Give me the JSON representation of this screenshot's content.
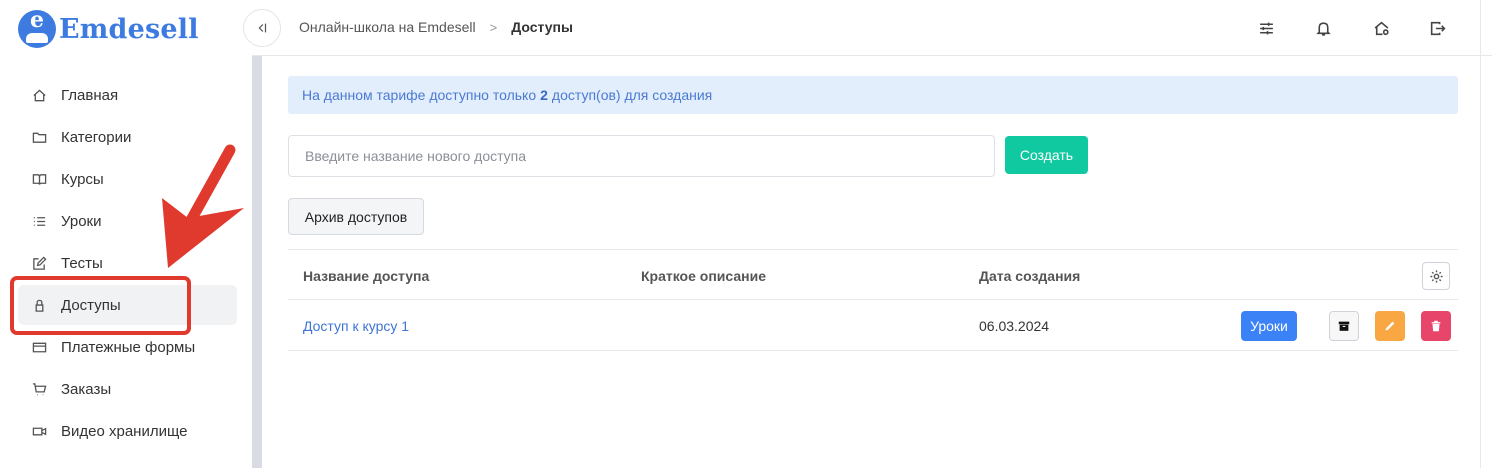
{
  "brand": {
    "name": "Emdesell",
    "badge_letter": "e",
    "color": "#3d7be0"
  },
  "sidebar": {
    "items": [
      {
        "label": "Главная",
        "icon": "home-icon",
        "active": false
      },
      {
        "label": "Категории",
        "icon": "folder-icon",
        "active": false
      },
      {
        "label": "Курсы",
        "icon": "book-icon",
        "active": false
      },
      {
        "label": "Уроки",
        "icon": "list-icon",
        "active": false
      },
      {
        "label": "Тесты",
        "icon": "edit-square-icon",
        "active": false
      },
      {
        "label": "Доступы",
        "icon": "lock-icon",
        "active": true
      },
      {
        "label": "Платежные формы",
        "icon": "credit-card-icon",
        "active": false
      },
      {
        "label": "Заказы",
        "icon": "cart-icon",
        "active": false
      },
      {
        "label": "Видео хранилище",
        "icon": "video-icon",
        "active": false
      }
    ]
  },
  "header": {
    "collapse_icon": "collapse-sidebar-icon",
    "breadcrumb": {
      "parent": "Онлайн-школа на Emdesell",
      "separator": ">",
      "current": "Доступы"
    },
    "icons": [
      "sliders-icon",
      "bell-icon",
      "home-settings-icon",
      "logout-icon"
    ]
  },
  "main": {
    "alert": {
      "prefix": "На данном тарифе доступно только",
      "count": "2",
      "suffix": "доступ(ов) для создания"
    },
    "new_access": {
      "placeholder": "Введите название нового доступа",
      "value": "",
      "button_label": "Создать"
    },
    "archive_label": "Архив доступов",
    "table": {
      "columns": [
        "Название доступа",
        "Краткое описание",
        "Дата создания"
      ],
      "rows": [
        {
          "name": "Доступ к курсу 1",
          "description": "",
          "date": "06.03.2024",
          "lessons_label": "Уроки"
        }
      ]
    }
  },
  "colors": {
    "accent": "#3b82f6",
    "create": "#10c9a0",
    "edit": "#f8a743",
    "delete": "#e8456b",
    "annotation": "#e03a2f",
    "alert_bg": "#e3eefd"
  }
}
